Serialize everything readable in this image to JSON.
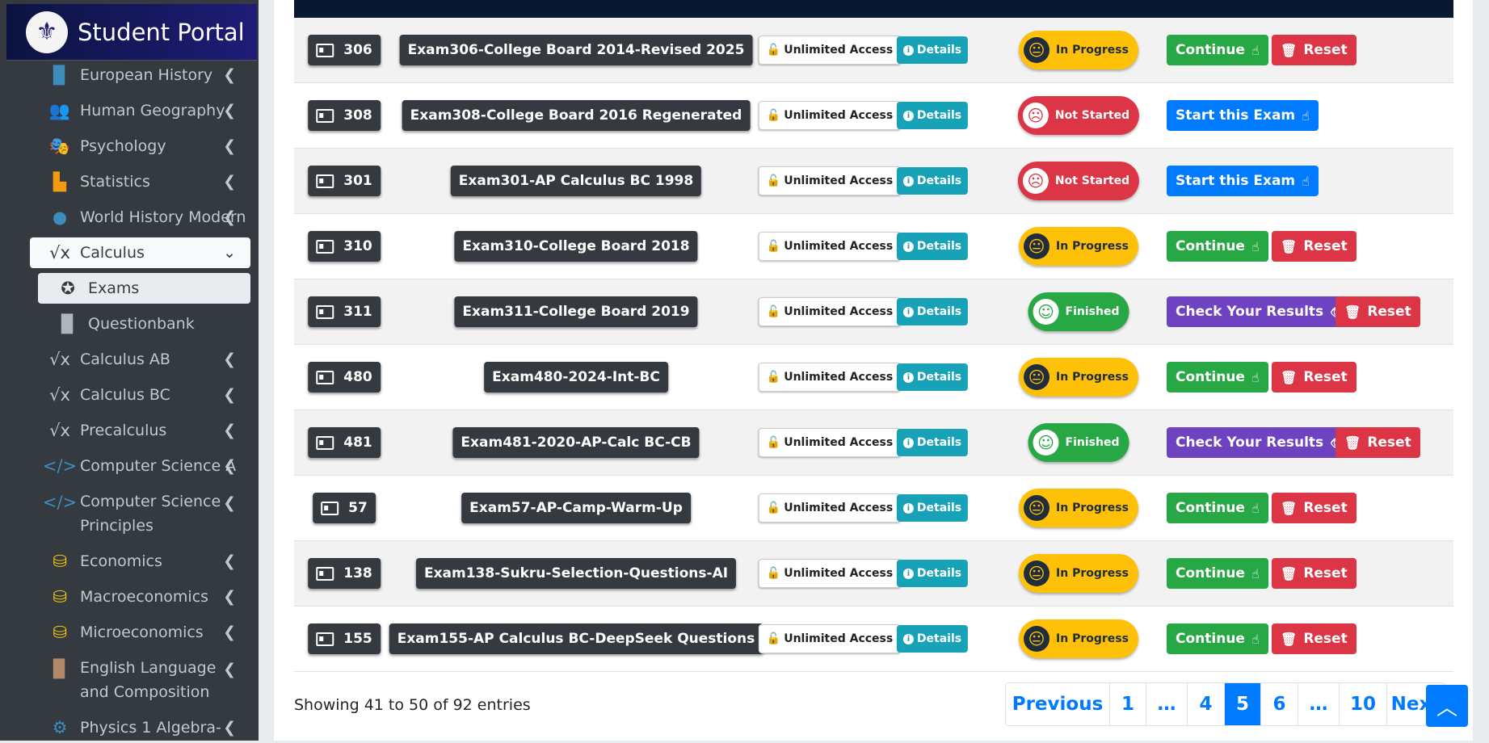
{
  "brand": {
    "title": "Student Portal",
    "logo_icon": "crest-icon"
  },
  "sidebar": {
    "items": [
      {
        "label": "European History",
        "icon": "book-icon",
        "icon_color": "#3c8dbc"
      },
      {
        "label": "Human Geography",
        "icon": "people-icon",
        "icon_color": "#d2d6de"
      },
      {
        "label": "Psychology",
        "icon": "masks-icon",
        "icon_color": "#8e5bd8"
      },
      {
        "label": "Statistics",
        "icon": "chart-icon",
        "icon_color": "#f39c12"
      },
      {
        "label": "World History Modern",
        "icon": "globe-icon",
        "icon_color": "#3c8dbc"
      },
      {
        "label": "Calculus",
        "icon": "sqrt-icon"
      },
      {
        "label": "Exams",
        "icon": "award-icon"
      },
      {
        "label": "Questionbank",
        "icon": "book-icon"
      },
      {
        "label": "Calculus AB",
        "icon": "sqrt-icon"
      },
      {
        "label": "Calculus BC",
        "icon": "sqrt-icon"
      },
      {
        "label": "Precalculus",
        "icon": "sqrt-icon"
      },
      {
        "label": "Computer Science A",
        "icon": "code-icon",
        "icon_color": "#3c8dbc"
      },
      {
        "label": "Computer Science Principles",
        "icon": "code-icon",
        "icon_color": "#3c8dbc"
      },
      {
        "label": "Economics",
        "icon": "coins-icon",
        "icon_color": "#f1c40f"
      },
      {
        "label": "Macroeconomics",
        "icon": "coins-icon",
        "icon_color": "#f1c40f"
      },
      {
        "label": "Microeconomics",
        "icon": "coins-icon",
        "icon_color": "#f1c40f"
      },
      {
        "label": "English Language and Composition",
        "icon": "book-icon",
        "icon_color": "#b08968"
      },
      {
        "label": "Physics 1 Algebra-",
        "icon": "gear-icon",
        "icon_color": "#3c8dbc"
      }
    ]
  },
  "labels": {
    "access": "Unlimited Access",
    "details": "Details",
    "continue": "Continue",
    "start": "Start this Exam",
    "results": "Check Your Results",
    "reset": "Reset"
  },
  "rows": [
    {
      "id": "306",
      "name": "Exam306-College Board 2014-Revised 2025",
      "status": "In Progress",
      "state": "progress"
    },
    {
      "id": "308",
      "name": "Exam308-College Board 2016 Regenerated",
      "status": "Not Started",
      "state": "notstarted"
    },
    {
      "id": "301",
      "name": "Exam301-AP Calculus BC 1998",
      "status": "Not Started",
      "state": "notstarted"
    },
    {
      "id": "310",
      "name": "Exam310-College Board 2018",
      "status": "In Progress",
      "state": "progress"
    },
    {
      "id": "311",
      "name": "Exam311-College Board 2019",
      "status": "Finished",
      "state": "finished"
    },
    {
      "id": "480",
      "name": "Exam480-2024-Int-BC",
      "status": "In Progress",
      "state": "progress"
    },
    {
      "id": "481",
      "name": "Exam481-2020-AP-Calc BC-CB",
      "status": "Finished",
      "state": "finished"
    },
    {
      "id": "57",
      "name": "Exam57-AP-Camp-Warm-Up",
      "status": "In Progress",
      "state": "progress"
    },
    {
      "id": "138",
      "name": "Exam138-Sukru-Selection-Questions-AI",
      "status": "In Progress",
      "state": "progress"
    },
    {
      "id": "155",
      "name": "Exam155-AP Calculus BC-DeepSeek Questions",
      "status": "In Progress",
      "state": "progress"
    }
  ],
  "footer": {
    "info": "Showing 41 to 50 of 92 entries",
    "pagination": [
      "Previous",
      "1",
      "…",
      "4",
      "5",
      "6",
      "…",
      "10",
      "Next"
    ],
    "active_page": "5"
  },
  "colors": {
    "primary": "#007bff",
    "success": "#28a745",
    "danger": "#dc3545",
    "warning": "#ffc107",
    "info": "#17a2b8",
    "purple": "#6f42c1"
  }
}
